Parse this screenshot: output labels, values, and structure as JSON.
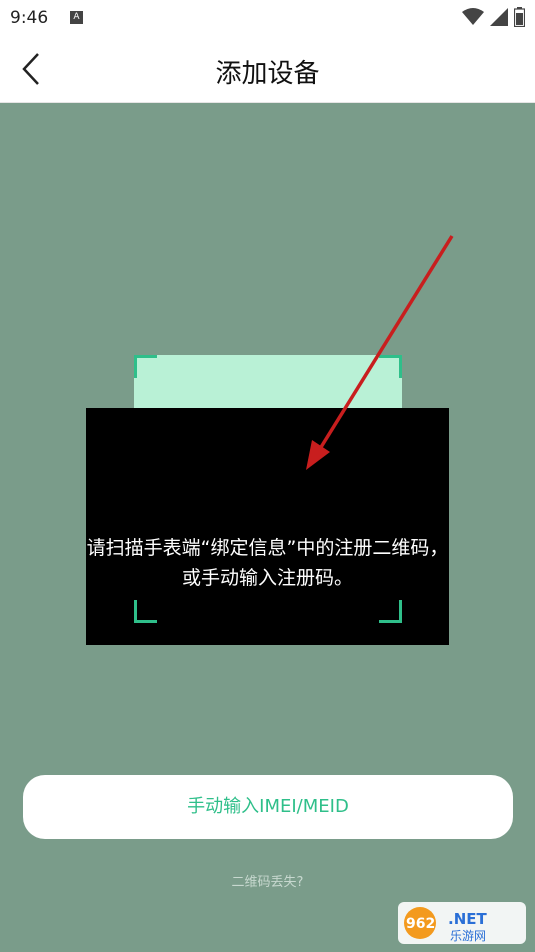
{
  "status_bar": {
    "time": "9:46",
    "notification_icon_letter": "A"
  },
  "header": {
    "title": "添加设备",
    "back_icon": "chevron-left-icon"
  },
  "scanner": {
    "instruction_line1": "请扫描手表端“绑定信息”中的注册二维码，",
    "instruction_line2": "或手动输入注册码。",
    "accent_color": "#2fbf8a"
  },
  "actions": {
    "manual_input_label": "手动输入IMEI/MEID",
    "lost_qr_label": "二维码丢失?"
  },
  "watermark": {
    "text_top": "962.NET",
    "text_bottom": "乐游网"
  }
}
